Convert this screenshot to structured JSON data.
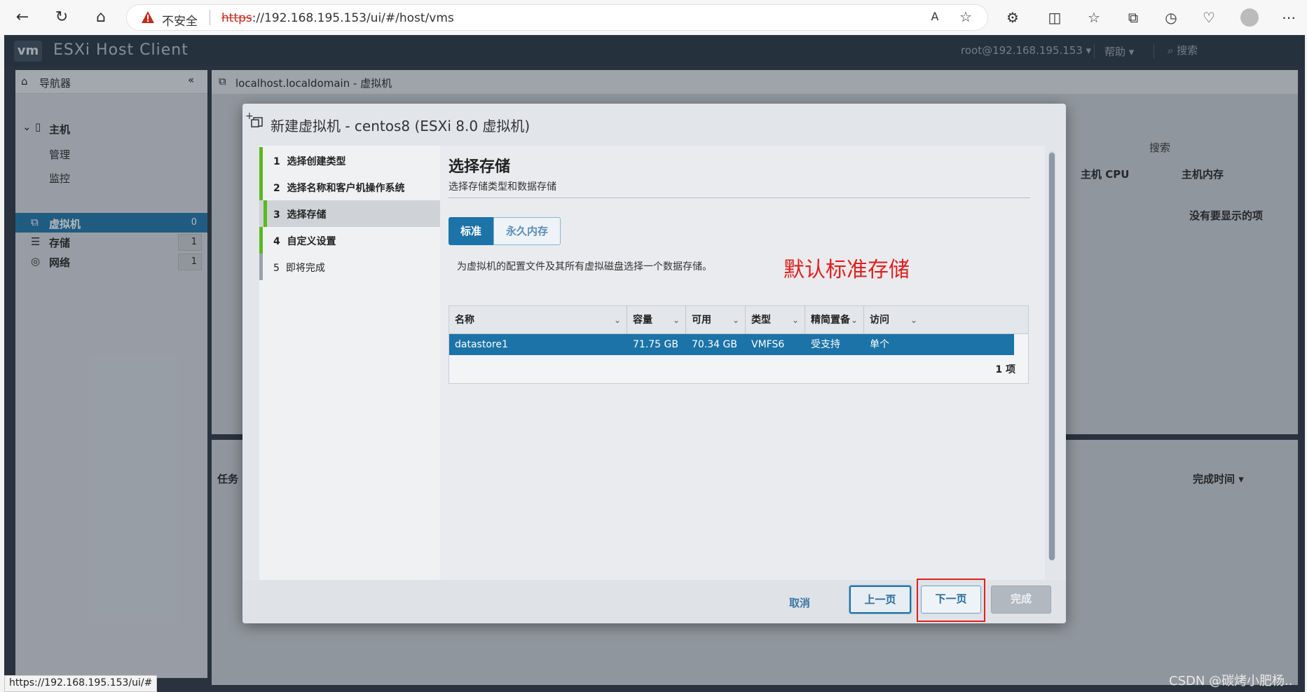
{
  "browser": {
    "insecure_label": "不安全",
    "url_https": "https",
    "url_rest": "://192.168.195.153/ui/#/host/vms",
    "status_url": "https://192.168.195.153/ui/#"
  },
  "app": {
    "logo": "vm",
    "title": "ESXi Host Client",
    "user": "root@192.168.195.153 ▾",
    "help": "帮助 ▾",
    "search": "搜索"
  },
  "navigator": {
    "title": "导航器",
    "host": "主机",
    "manage": "管理",
    "monitor": "监控",
    "vms": "虚拟机",
    "vms_count": "0",
    "storage": "存储",
    "storage_count": "1",
    "network": "网络",
    "network_count": "1"
  },
  "main": {
    "title": "localhost.localdomain - 虚拟机",
    "search_placeholder": "搜索",
    "col_cpu": "主机 CPU",
    "col_mem": "主机内存",
    "empty": "没有要显示的项",
    "tasks_col": "任务",
    "finish_time": "完成时间 ▾"
  },
  "dialog": {
    "title": "新建虚拟机 - centos8 (ESXi 8.0 虚拟机)",
    "steps": [
      {
        "num": "1",
        "label": "选择创建类型"
      },
      {
        "num": "2",
        "label": "选择名称和客户机操作系统"
      },
      {
        "num": "3",
        "label": "选择存储"
      },
      {
        "num": "4",
        "label": "自定义设置"
      },
      {
        "num": "5",
        "label": "即将完成"
      }
    ],
    "heading": "选择存储",
    "subheading": "选择存储类型和数据存储",
    "tab_standard": "标准",
    "tab_persistent": "永久内存",
    "description": "为虚拟机的配置文件及其所有虚拟磁盘选择一个数据存储。",
    "annotation": "默认标准存储",
    "table": {
      "headers": [
        "名称",
        "容量",
        "可用",
        "类型",
        "精简置备",
        "访问"
      ],
      "rows": [
        [
          "datastore1",
          "71.75 GB",
          "70.34 GB",
          "VMFS6",
          "受支持",
          "单个"
        ]
      ],
      "count": "1 项"
    },
    "buttons": {
      "cancel": "取消",
      "prev": "上一页",
      "next": "下一页",
      "finish": "完成"
    }
  },
  "watermark": "CSDN @碳烤小肥杨..",
  "colors": {
    "accent": "#1c73a7",
    "step_complete": "#5db81f",
    "annotation": "#e0201f"
  }
}
